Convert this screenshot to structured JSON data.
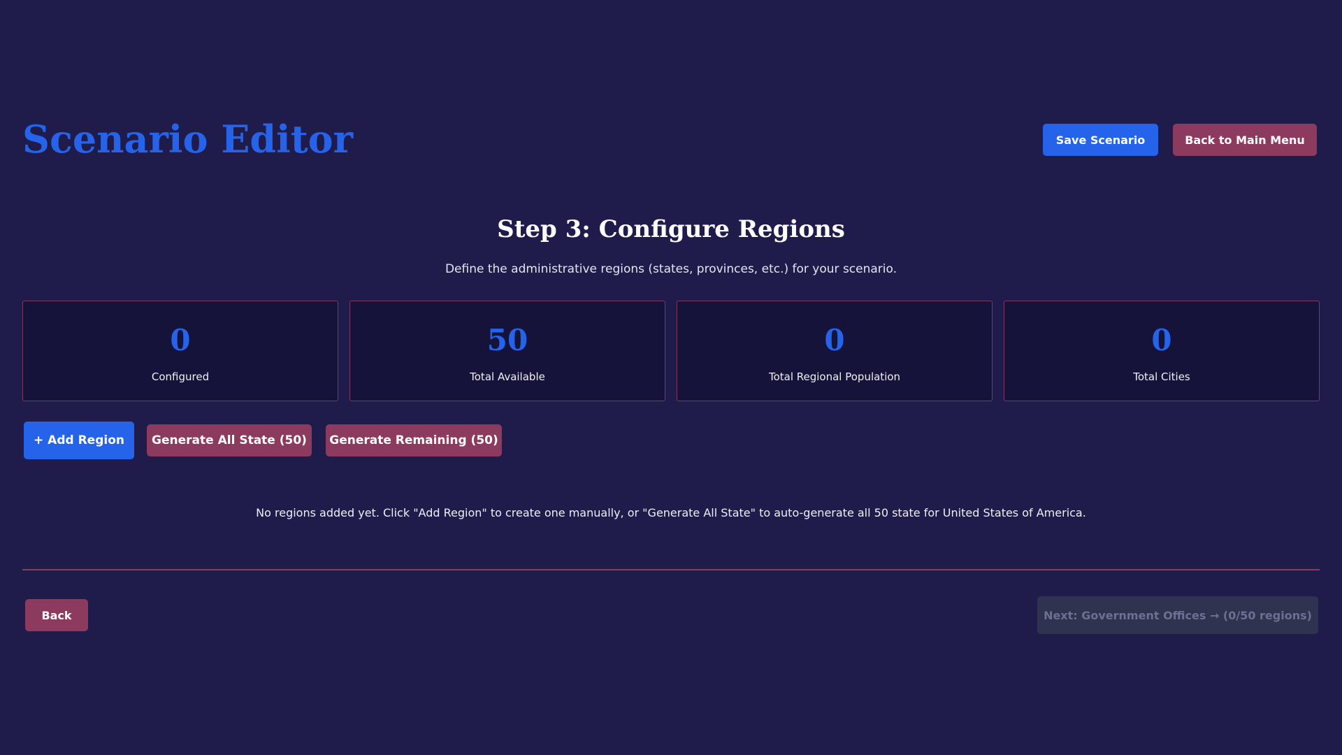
{
  "header": {
    "title": "Scenario Editor",
    "save_label": "Save Scenario",
    "main_menu_label": "Back to Main Menu"
  },
  "step": {
    "title": "Step 3: Configure Regions",
    "description": "Define the administrative regions (states, provinces, etc.) for your scenario."
  },
  "stats": [
    {
      "value": "0",
      "label": "Configured"
    },
    {
      "value": "50",
      "label": "Total Available"
    },
    {
      "value": "0",
      "label": "Total Regional Population"
    },
    {
      "value": "0",
      "label": "Total Cities"
    }
  ],
  "actions": {
    "add_region_label": "+ Add Region",
    "generate_all_label": "Generate All State (50)",
    "generate_remaining_label": "Generate Remaining (50)"
  },
  "empty_message": "No regions added yet. Click \"Add Region\" to create one manually, or \"Generate All State\" to auto-generate all 50 state for United States of America.",
  "footer": {
    "back_label": "Back",
    "next_label": "Next: Government Offices → (0/50 regions)",
    "next_disabled": true
  },
  "colors": {
    "background": "#1f1b4b",
    "accent_blue": "#2563eb",
    "accent_maroon": "#8c3a5e",
    "card_background": "#16133a",
    "disabled": "#2f3350"
  }
}
